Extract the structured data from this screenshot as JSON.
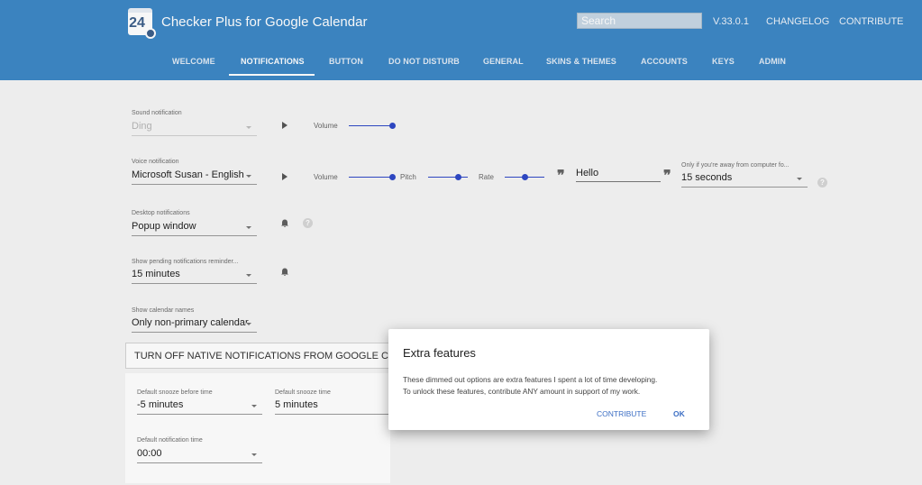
{
  "header": {
    "logo_number": "24",
    "app_title": "Checker Plus for Google Calendar",
    "search_placeholder": "Search",
    "version": "V.33.0.1",
    "changelog": "CHANGELOG",
    "contribute": "CONTRIBUTE",
    "tabs": [
      {
        "label": "WELCOME",
        "active": false
      },
      {
        "label": "NOTIFICATIONS",
        "active": true
      },
      {
        "label": "BUTTON",
        "active": false
      },
      {
        "label": "DO NOT DISTURB",
        "active": false
      },
      {
        "label": "GENERAL",
        "active": false
      },
      {
        "label": "SKINS & THEMES",
        "active": false
      },
      {
        "label": "ACCOUNTS",
        "active": false
      },
      {
        "label": "KEYS",
        "active": false
      },
      {
        "label": "ADMIN",
        "active": false
      }
    ]
  },
  "settings": {
    "sound": {
      "label": "Sound notification",
      "value": "Ding",
      "volume_label": "Volume",
      "volume": 1.0,
      "disabled": true
    },
    "voice": {
      "label": "Voice notification",
      "value": "Microsoft Susan - English",
      "volume_label": "Volume",
      "volume": 1.0,
      "pitch_label": "Pitch",
      "pitch": 0.75,
      "rate_label": "Rate",
      "rate": 0.5,
      "test_text": "Hello",
      "away_label": "Only if you're away from computer fo...",
      "away_value": "15 seconds"
    },
    "desktop": {
      "label": "Desktop notifications",
      "value": "Popup window"
    },
    "pending": {
      "label": "Show pending notifications reminder...",
      "value": "15 minutes"
    },
    "calendar_names": {
      "label": "Show calendar names",
      "value": "Only non-primary calendar"
    },
    "turn_off_native": "TURN OFF NATIVE NOTIFICATIONS FROM GOOGLE CALENDAR",
    "snooze_before": {
      "label": "Default snooze before time",
      "value": "-5 minutes"
    },
    "snooze": {
      "label": "Default snooze time",
      "value": "5 minutes"
    },
    "notification_time": {
      "label": "Default notification time",
      "value": "00:00"
    }
  },
  "dialog": {
    "title": "Extra features",
    "line1": "These dimmed out options are extra features I spent a lot of time developing.",
    "line2": "To unlock these features, contribute ANY amount in support of my work.",
    "contribute_label": "CONTRIBUTE",
    "ok_label": "OK"
  },
  "colors": {
    "header": "#3d88c6",
    "accent": "#2f49c7",
    "dialog_button": "#3d6fc4"
  },
  "icons": [
    "calendar-logo-icon",
    "play-icon",
    "bell-icon",
    "help-icon",
    "quote-open-icon",
    "quote-close-icon",
    "dropdown-caret-icon"
  ]
}
